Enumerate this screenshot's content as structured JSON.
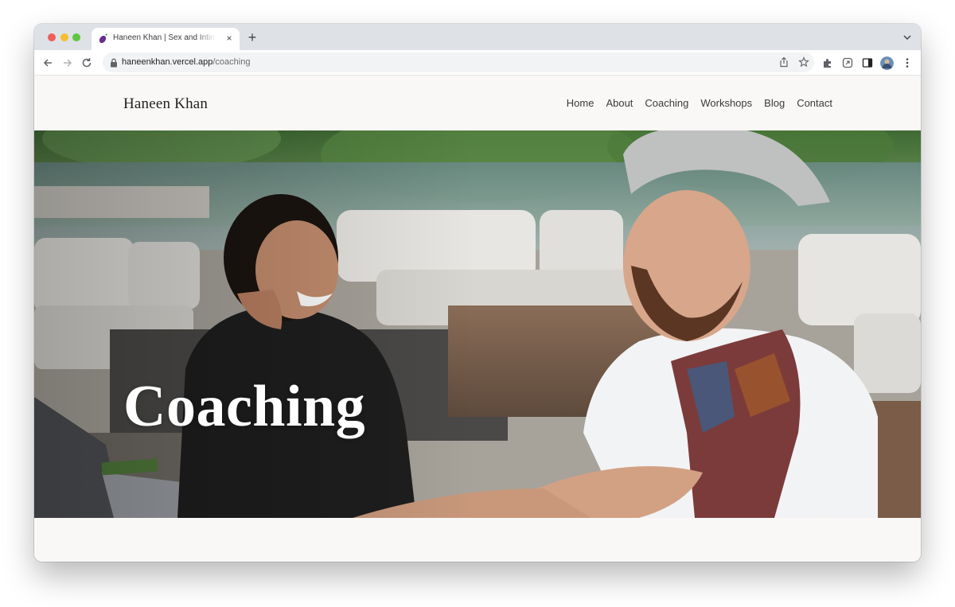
{
  "browser": {
    "tab_title": "Haneen Khan | Sex and Intimacy",
    "tab_close": "×",
    "new_tab": "+",
    "url_host": "haneenkhan.vercel.app",
    "url_path": "/coaching"
  },
  "site": {
    "brand": "Haneen Khan",
    "nav": [
      "Home",
      "About",
      "Coaching",
      "Workshops",
      "Blog",
      "Contact"
    ]
  },
  "hero": {
    "title": "Coaching"
  },
  "colors": {
    "page_bg": "#f9f8f6",
    "hero_title": "#ffffff",
    "tab_strip": "#dee1e6"
  }
}
